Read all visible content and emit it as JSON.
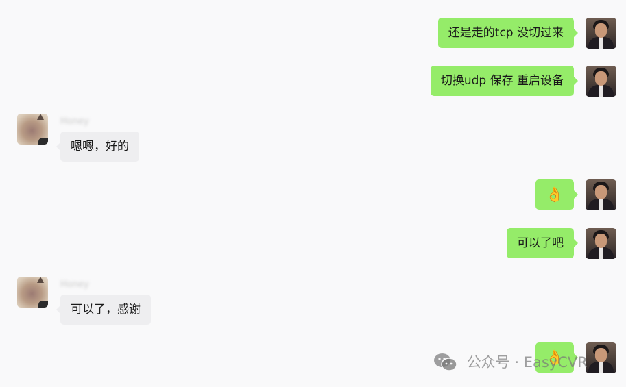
{
  "colors": {
    "self_bubble": "#95ec69",
    "other_bubble": "#eeeef0",
    "background": "#f9f9fa"
  },
  "messages": [
    {
      "side": "self",
      "type": "text",
      "text": "还是走的tcp  没切过来"
    },
    {
      "side": "self",
      "type": "text",
      "text": "切换udp 保存  重启设备"
    },
    {
      "side": "other",
      "sender": "Honey",
      "type": "text",
      "text": "嗯嗯，好的"
    },
    {
      "side": "self",
      "type": "emoji",
      "text": "👌",
      "icon": "ok-hand-emoji"
    },
    {
      "side": "self",
      "type": "text",
      "text": "可以了吧"
    },
    {
      "side": "other",
      "sender": "Honey",
      "type": "text",
      "text": "可以了，感谢"
    },
    {
      "side": "self",
      "type": "emoji",
      "text": "👌",
      "icon": "ok-hand-emoji"
    }
  ],
  "watermark": {
    "icon": "wechat-icon",
    "text": "公众号 · EasyCVR"
  }
}
